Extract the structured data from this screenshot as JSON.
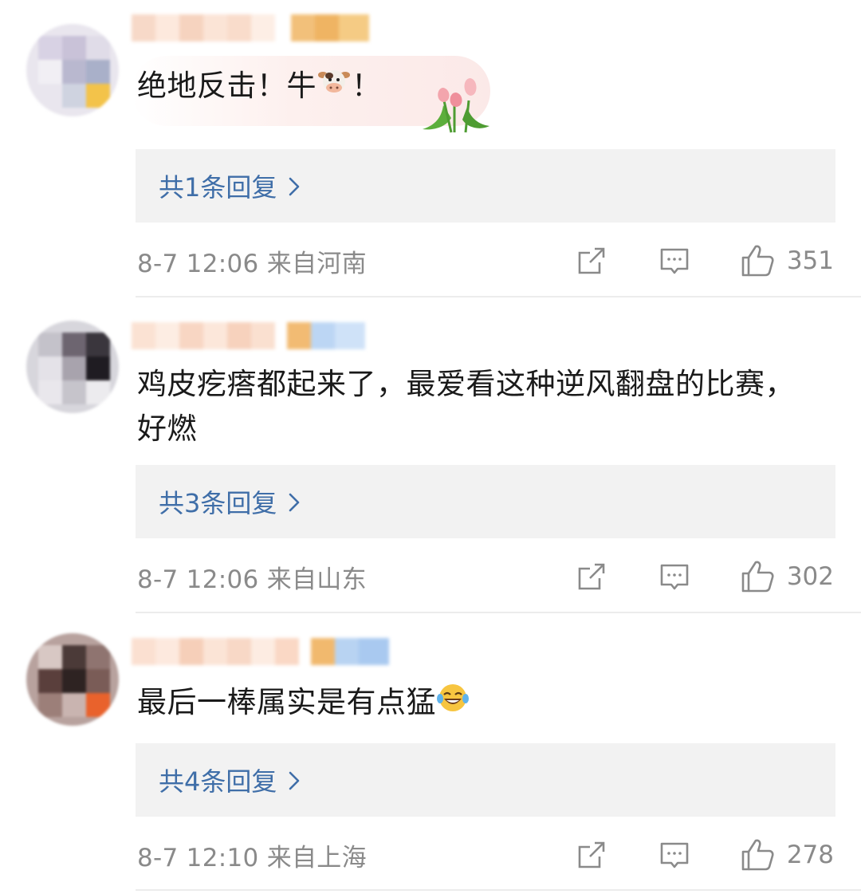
{
  "comments": [
    {
      "text": "绝地反击！牛",
      "text_suffix": "！",
      "inline_emoji": "cow-face-icon",
      "decoration": "tulip-sticker",
      "reply_label": "共1条回复",
      "time": "8-7 12:06",
      "location": "来自河南",
      "likes": "351"
    },
    {
      "text": "鸡皮疙瘩都起来了，最爱看这种逆风翻盘的比赛，好燃",
      "reply_label": "共3条回复",
      "time": "8-7 12:06",
      "location": "来自山东",
      "likes": "302"
    },
    {
      "text": "最后一棒属实是有点猛",
      "inline_emoji": "laughing-tears-icon",
      "reply_label": "共4条回复",
      "time": "8-7 12:10",
      "location": "来自上海",
      "likes": "278"
    }
  ],
  "colors": {
    "link": "#3f6ea8",
    "meta": "#8a8a8a",
    "reply_bg": "#f2f2f2",
    "divider": "#ececec"
  }
}
